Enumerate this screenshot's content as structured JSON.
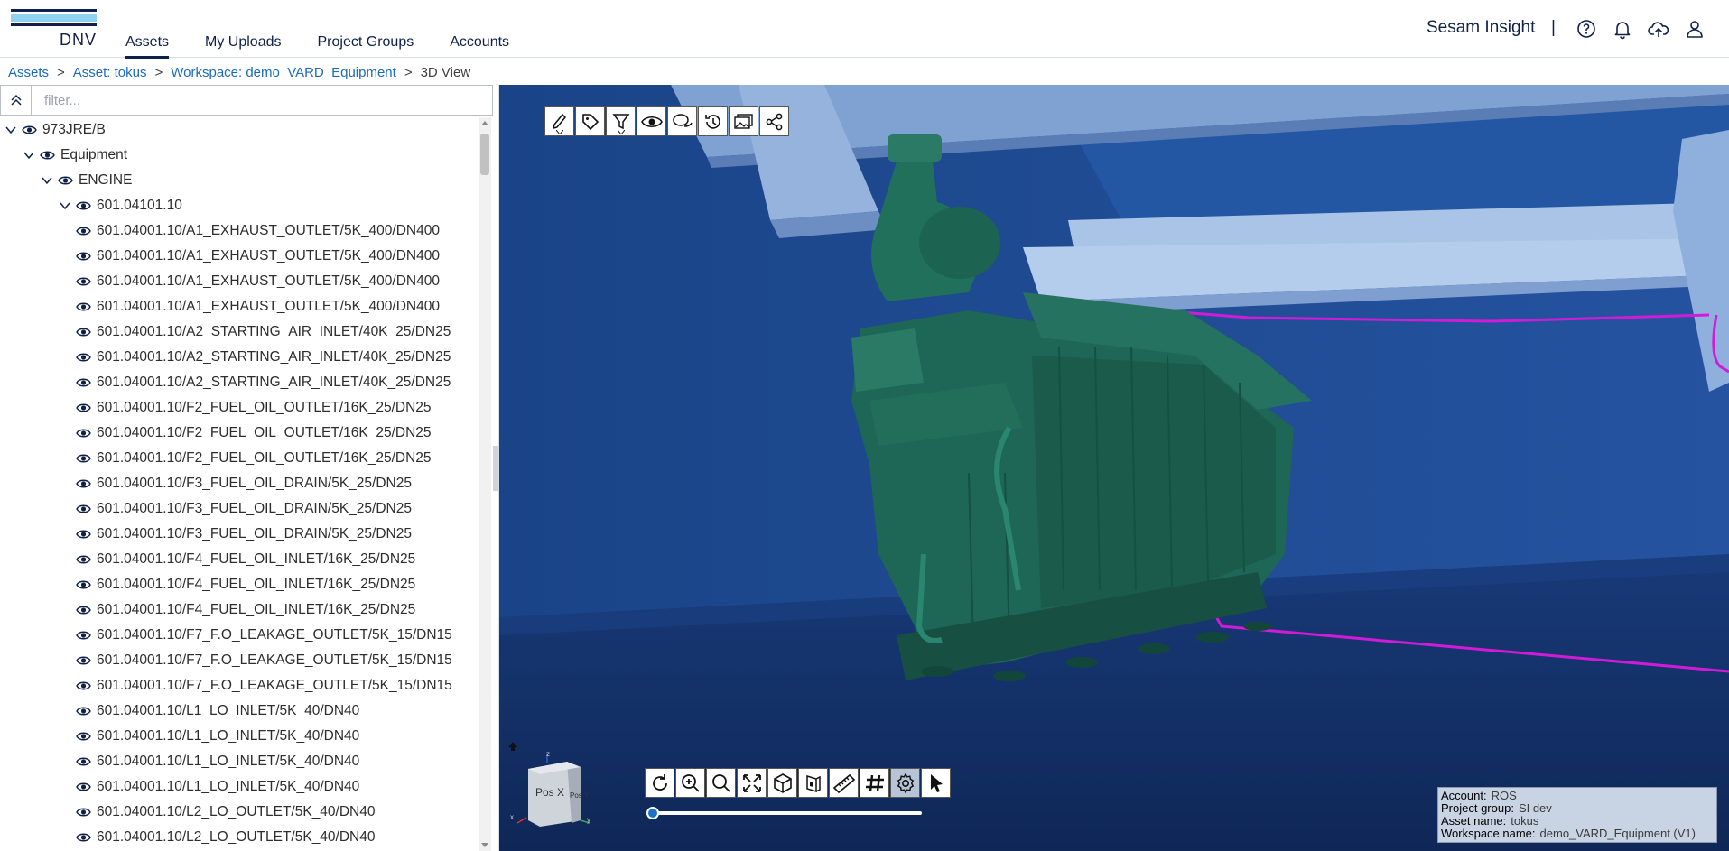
{
  "header": {
    "logo_text": "DNV",
    "nav": [
      {
        "label": "Assets",
        "active": true
      },
      {
        "label": "My Uploads",
        "active": false
      },
      {
        "label": "Project Groups",
        "active": false
      },
      {
        "label": "Accounts",
        "active": false
      }
    ],
    "brand": "Sesam Insight",
    "brand_separator": "|",
    "icons": [
      "help-icon",
      "bell-icon",
      "upload-icon",
      "user-icon"
    ]
  },
  "breadcrumb": {
    "items": [
      "Assets",
      "Asset: tokus",
      "Workspace: demo_VARD_Equipment",
      "3D View"
    ],
    "separator": ">"
  },
  "tree": {
    "filter_placeholder": "filter...",
    "nodes": [
      {
        "label": "973JRE/B",
        "level": 0,
        "expandable": true
      },
      {
        "label": "Equipment",
        "level": 1,
        "expandable": true
      },
      {
        "label": "ENGINE",
        "level": 2,
        "expandable": true
      },
      {
        "label": "601.04101.10",
        "level": 3,
        "expandable": true
      },
      {
        "label": "601.04001.10/A1_EXHAUST_OUTLET/5K_400/DN400",
        "level": 4,
        "expandable": false
      },
      {
        "label": "601.04001.10/A1_EXHAUST_OUTLET/5K_400/DN400",
        "level": 4,
        "expandable": false
      },
      {
        "label": "601.04001.10/A1_EXHAUST_OUTLET/5K_400/DN400",
        "level": 4,
        "expandable": false
      },
      {
        "label": "601.04001.10/A1_EXHAUST_OUTLET/5K_400/DN400",
        "level": 4,
        "expandable": false
      },
      {
        "label": "601.04001.10/A2_STARTING_AIR_INLET/40K_25/DN25",
        "level": 4,
        "expandable": false
      },
      {
        "label": "601.04001.10/A2_STARTING_AIR_INLET/40K_25/DN25",
        "level": 4,
        "expandable": false
      },
      {
        "label": "601.04001.10/A2_STARTING_AIR_INLET/40K_25/DN25",
        "level": 4,
        "expandable": false
      },
      {
        "label": "601.04001.10/F2_FUEL_OIL_OUTLET/16K_25/DN25",
        "level": 4,
        "expandable": false
      },
      {
        "label": "601.04001.10/F2_FUEL_OIL_OUTLET/16K_25/DN25",
        "level": 4,
        "expandable": false
      },
      {
        "label": "601.04001.10/F2_FUEL_OIL_OUTLET/16K_25/DN25",
        "level": 4,
        "expandable": false
      },
      {
        "label": "601.04001.10/F3_FUEL_OIL_DRAIN/5K_25/DN25",
        "level": 4,
        "expandable": false
      },
      {
        "label": "601.04001.10/F3_FUEL_OIL_DRAIN/5K_25/DN25",
        "level": 4,
        "expandable": false
      },
      {
        "label": "601.04001.10/F3_FUEL_OIL_DRAIN/5K_25/DN25",
        "level": 4,
        "expandable": false
      },
      {
        "label": "601.04001.10/F4_FUEL_OIL_INLET/16K_25/DN25",
        "level": 4,
        "expandable": false
      },
      {
        "label": "601.04001.10/F4_FUEL_OIL_INLET/16K_25/DN25",
        "level": 4,
        "expandable": false
      },
      {
        "label": "601.04001.10/F4_FUEL_OIL_INLET/16K_25/DN25",
        "level": 4,
        "expandable": false
      },
      {
        "label": "601.04001.10/F7_F.O_LEAKAGE_OUTLET/5K_15/DN15",
        "level": 4,
        "expandable": false
      },
      {
        "label": "601.04001.10/F7_F.O_LEAKAGE_OUTLET/5K_15/DN15",
        "level": 4,
        "expandable": false
      },
      {
        "label": "601.04001.10/F7_F.O_LEAKAGE_OUTLET/5K_15/DN15",
        "level": 4,
        "expandable": false
      },
      {
        "label": "601.04001.10/L1_LO_INLET/5K_40/DN40",
        "level": 4,
        "expandable": false
      },
      {
        "label": "601.04001.10/L1_LO_INLET/5K_40/DN40",
        "level": 4,
        "expandable": false
      },
      {
        "label": "601.04001.10/L1_LO_INLET/5K_40/DN40",
        "level": 4,
        "expandable": false
      },
      {
        "label": "601.04001.10/L1_LO_INLET/5K_40/DN40",
        "level": 4,
        "expandable": false
      },
      {
        "label": "601.04001.10/L2_LO_OUTLET/5K_40/DN40",
        "level": 4,
        "expandable": false
      },
      {
        "label": "601.04001.10/L2_LO_OUTLET/5K_40/DN40",
        "level": 4,
        "expandable": false
      }
    ]
  },
  "viewer": {
    "top_toolbar": [
      "brush-icon",
      "tag-icon",
      "filter-icon",
      "eye-icon",
      "comments-icon",
      "history-icon",
      "gallery-icon",
      "share-icon"
    ],
    "bottom_toolbar": [
      "rotate-icon",
      "zoom-in-icon",
      "zoom-icon",
      "fit-icon",
      "cube-icon",
      "section-icon",
      "ruler-icon",
      "grid-icon",
      "settings-icon",
      "pointer-icon"
    ],
    "active_tool": "settings-icon",
    "nav_cube": {
      "front": "Pos X",
      "side": "Pos Y",
      "axis_z": "z",
      "axis_x": "x",
      "axis_y": "y"
    },
    "info": {
      "account_label": "Account:",
      "account": "ROS",
      "project_group_label": "Project group:",
      "project_group": "SI dev",
      "asset_name_label": "Asset name:",
      "asset_name": "tokus",
      "workspace_name_label": "Workspace name:",
      "workspace_name": "demo_VARD_Equipment (V1)"
    },
    "colors": {
      "background": "#1d4c91",
      "engine": "#1e6656",
      "pipe": "#d21bd8",
      "beam": "#a9c4e6"
    }
  }
}
